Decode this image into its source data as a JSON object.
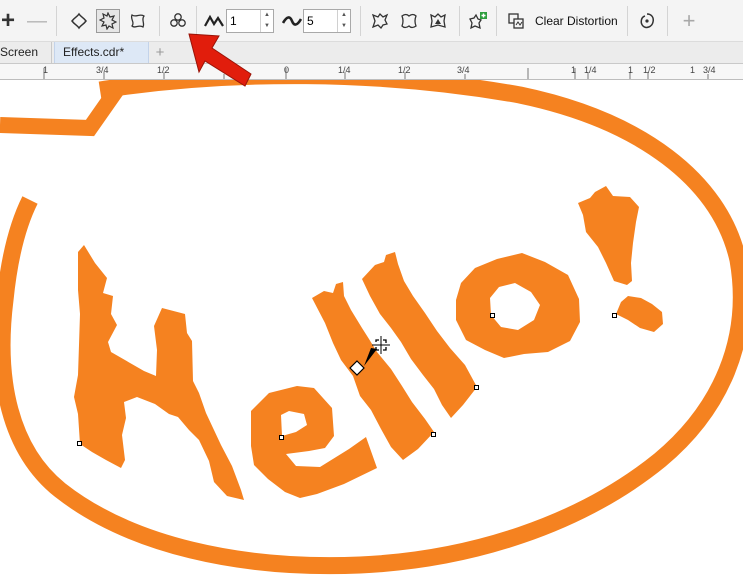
{
  "toolbar": {
    "add_label": "+",
    "remove_label": "—",
    "amplitude_value": "1",
    "frequency_value": "5",
    "clear_distortion_label": "Clear Distortion",
    "plus_label": "+",
    "icons": [
      "push-pull-distortion-icon",
      "zipper-distortion-icon",
      "twister-distortion-icon",
      "add-new-distortion-icon",
      "amplitude-icon",
      "frequency-icon",
      "random-distortion-icon",
      "smooth-distortion-icon",
      "local-distortion-icon",
      "copy-distortion-icon",
      "convert-to-curves-icon",
      "center-distortion-icon"
    ]
  },
  "tabs": [
    {
      "label": "Screen"
    },
    {
      "label": "Effects.cdr*"
    },
    {
      "label": "+"
    }
  ],
  "ruler": {
    "labels": [
      "1",
      "3/4",
      "1/2",
      "0",
      "1/4",
      "1/2",
      "3/4",
      "1",
      "1/4",
      "1",
      "1/2",
      "1",
      "3/4"
    ]
  },
  "canvas": {
    "text": "Hello!",
    "fill_color": "#f58220",
    "stroke_color": "#f58220"
  },
  "annotation": {
    "arrow_color": "#e11d0c"
  }
}
